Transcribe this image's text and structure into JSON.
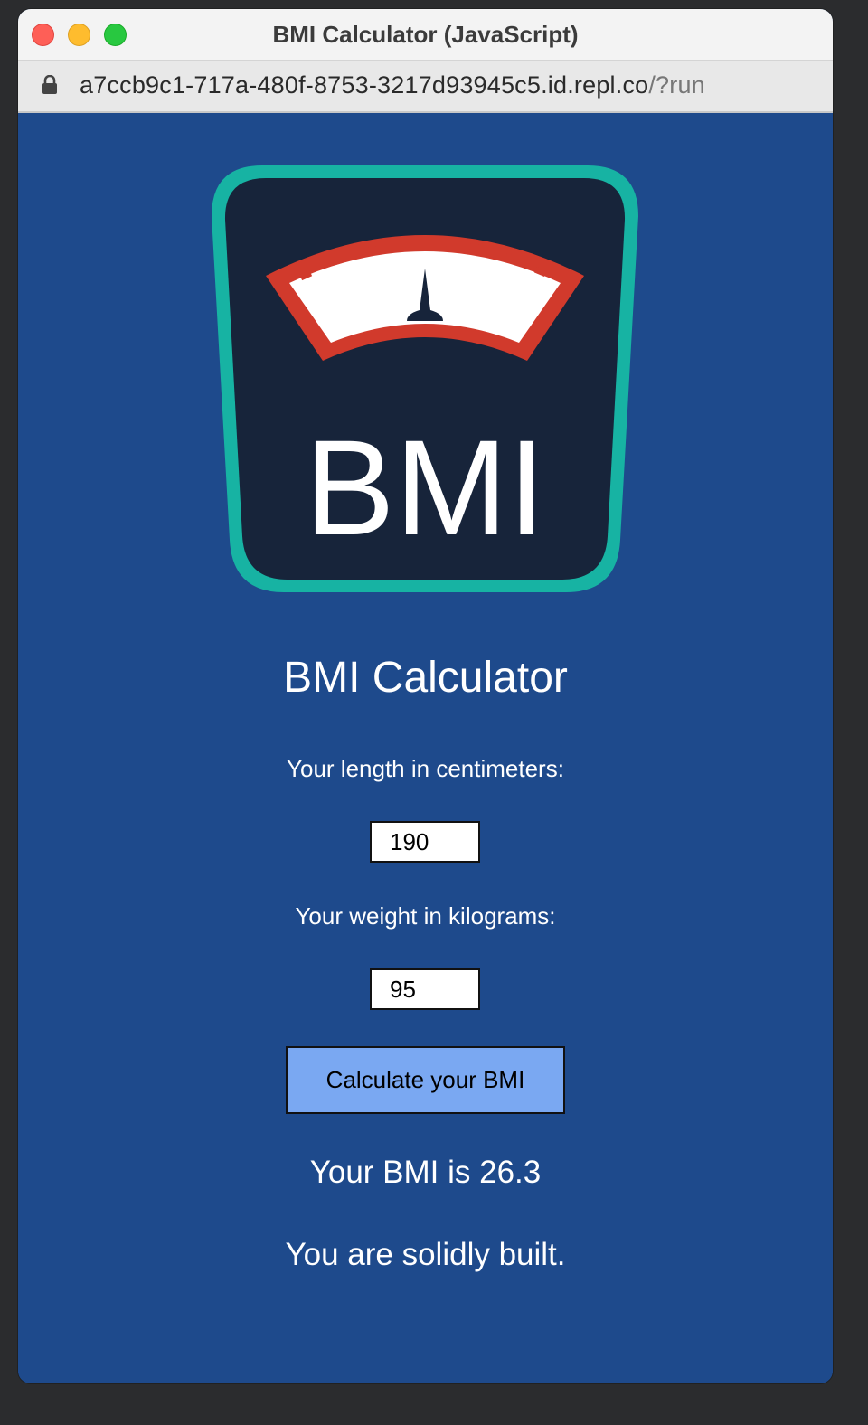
{
  "window": {
    "title": "BMI Calculator (JavaScript)"
  },
  "address_bar": {
    "host": "a7ccb9c1-717a-480f-8753-3217d93945c5.id.repl.co",
    "path": "/?run"
  },
  "logo": {
    "text": "BMI",
    "icon": "bmi-scale-logo"
  },
  "page": {
    "heading": "BMI Calculator",
    "length_label": "Your length in centimeters:",
    "length_value": "190",
    "weight_label": "Your weight in kilograms:",
    "weight_value": "95",
    "calculate_button": "Calculate your BMI",
    "bmi_result": "Your BMI is 26.3",
    "verdict": "You are solidly built."
  },
  "colors": {
    "page_background": "#1e4a8c",
    "button_background": "#7aa8f2",
    "logo_border": "#17b3a3",
    "logo_fill": "#17243a",
    "gauge_red": "#d13a2c"
  }
}
